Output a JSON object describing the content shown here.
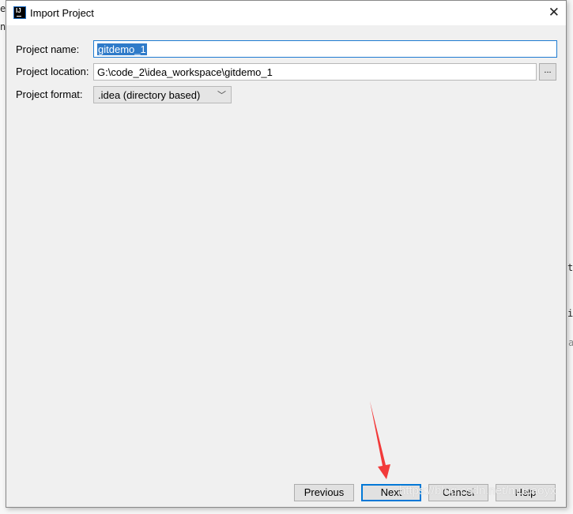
{
  "dialog": {
    "title": "Import Project",
    "icon": "intellij-idea-icon",
    "fields": {
      "project_name_label": "Project name:",
      "project_name_value": "gitdemo_1",
      "project_location_label": "Project location:",
      "project_location_value": "G:\\code_2\\idea_workspace\\gitdemo_1",
      "browse_label": "...",
      "project_format_label": "Project format:",
      "project_format_value": ".idea (directory based)"
    },
    "buttons": {
      "previous": "Previous",
      "next": "Next",
      "cancel": "Cancel",
      "help": "Help"
    }
  },
  "background_fragments": [
    "es",
    "n",
    "tr",
    "ip",
    "a"
  ],
  "watermark": "https://blog.csdn.net/mucaoyx",
  "colors": {
    "focus": "#1e7bd1",
    "selection": "#2f7bc9",
    "annotation_arrow": "#f23a3a"
  }
}
